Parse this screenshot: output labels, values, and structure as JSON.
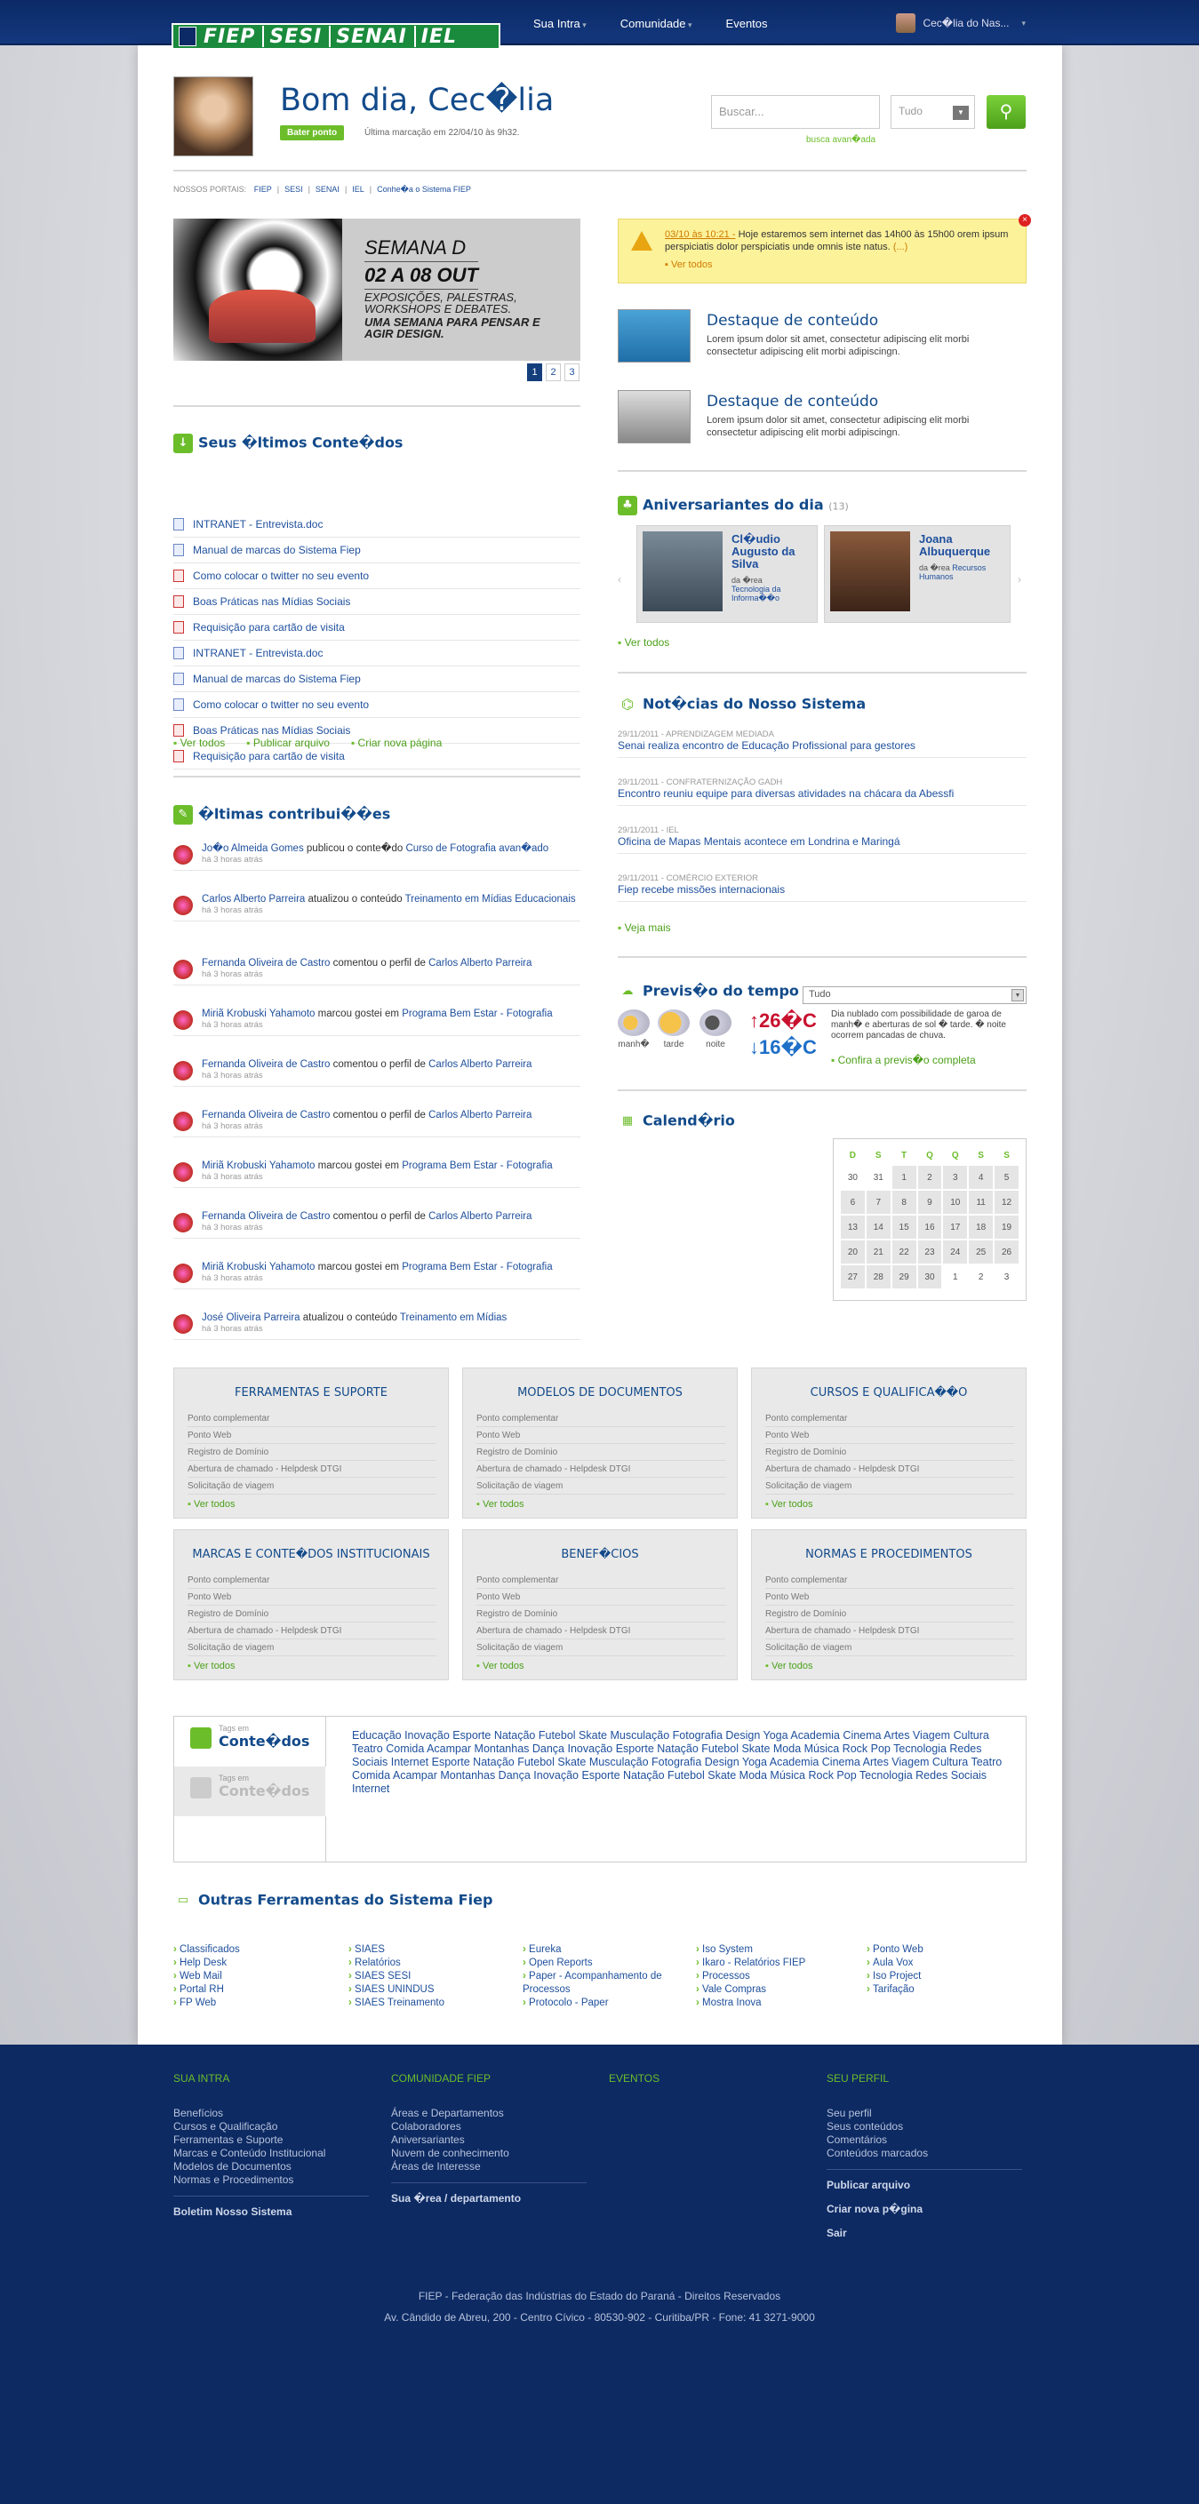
{
  "topbar": {
    "logo": [
      "FIEP",
      "SESI",
      "SENAI",
      "IEL"
    ],
    "nav": [
      {
        "label": "Sua Intra",
        "dropdown": true
      },
      {
        "label": "Comunidade",
        "dropdown": true
      },
      {
        "label": "Eventos",
        "dropdown": false
      }
    ],
    "user": "Cec�lia do Nas..."
  },
  "profile": {
    "greeting": "Bom dia, Cec�lia",
    "punch_button": "Bater ponto",
    "last_mark": "Última marcação em 22/04/10 às 9h32."
  },
  "search": {
    "placeholder": "Buscar...",
    "scope": "Tudo",
    "advanced": "busca avan�ada"
  },
  "portals": {
    "label": "NOSSOS PORTAIS:",
    "links": [
      "FIEP",
      "SESI",
      "SENAI",
      "IEL",
      "Conhe�a o Sistema FIEP"
    ]
  },
  "banner": {
    "title": "SEMANA D",
    "dates": "02 A 08 OUT",
    "body": "EXPOSIÇÕES, PALESTRAS, WORKSHOPS E DEBATES.",
    "tagline": "UMA SEMANA PARA PENSAR E AGIR DESIGN.",
    "pages": [
      "1",
      "2",
      "3"
    ]
  },
  "alert": {
    "date": "03/10 às 10:21 -",
    "text": "Hoje estaremos sem internet das 14h00 às 15h00 orem ipsum perspiciatis dolor perspiciatis unde omnis iste natus.",
    "more": "(...)",
    "see_all": "Ver todos"
  },
  "highlights": [
    {
      "title": "Destaque de conteúdo",
      "text": "Lorem ipsum dolor sit amet, consectetur adipiscing elit morbi consectetur adipiscing elit morbi adipiscingn."
    },
    {
      "title": "Destaque de conteúdo",
      "text": "Lorem ipsum dolor sit amet, consectetur adipiscing elit morbi consectetur adipiscing elit morbi adipiscingn."
    }
  ],
  "contents": {
    "title": "Seus �ltimos Conte�dos",
    "files": [
      {
        "name": "INTRANET - Entrevista.doc",
        "type": "doc"
      },
      {
        "name": "Manual de marcas do Sistema Fiep",
        "type": "doc"
      },
      {
        "name": "Como colocar o twitter no seu evento",
        "type": "pdf"
      },
      {
        "name": "Boas Práticas nas Mídias Sociais",
        "type": "pdf"
      },
      {
        "name": "Requisição para cartão de visita",
        "type": "pdf"
      },
      {
        "name": "INTRANET - Entrevista.doc",
        "type": "doc"
      },
      {
        "name": "Manual de marcas do Sistema Fiep",
        "type": "doc"
      },
      {
        "name": "Como colocar o twitter no seu evento",
        "type": "doc"
      },
      {
        "name": "Boas Práticas nas Mídias Sociais",
        "type": "pdf"
      },
      {
        "name": "Requisição para cartão de visita",
        "type": "pdf"
      }
    ],
    "links": [
      "Ver todos",
      "Publicar arquivo",
      "Criar nova página"
    ]
  },
  "contributions": {
    "title": "�ltimas contribui��es",
    "items": [
      {
        "actor": "Jo�o Almeida Gomes",
        "action": " publicou o conte�do ",
        "target": "Curso de Fotografia avan�ado",
        "time": "há 3 horas atrás"
      },
      {
        "actor": "Carlos Alberto Parreira",
        "action": " atualizou o conteúdo ",
        "target": "Treinamento em Mídias Educacionais",
        "time": "há 3 horas atrás"
      },
      {
        "actor": "Fernanda Oliveira de Castro",
        "action": " comentou o perfil de ",
        "target": "Carlos Alberto Parreira",
        "time": "há 3 horas atrás"
      },
      {
        "actor": "Miriã Krobuski Yahamoto",
        "action": " marcou gostei em ",
        "target": "Programa Bem Estar - Fotografia",
        "time": "há 3 horas atrás"
      },
      {
        "actor": "Fernanda Oliveira de Castro",
        "action": " comentou o perfil de ",
        "target": "Carlos Alberto Parreira",
        "time": "há 3 horas atrás"
      },
      {
        "actor": "Fernanda Oliveira de Castro",
        "action": " comentou o perfil de ",
        "target": "Carlos Alberto Parreira",
        "time": "há 3 horas atrás"
      },
      {
        "actor": "Miriã Krobuski Yahamoto",
        "action": " marcou gostei em ",
        "target": "Programa Bem Estar - Fotografia",
        "time": "há 3 horas atrás"
      },
      {
        "actor": "Fernanda Oliveira de Castro",
        "action": " comentou o perfil de ",
        "target": "Carlos Alberto Parreira",
        "time": "há 3 horas atrás"
      },
      {
        "actor": "Miriã Krobuski Yahamoto",
        "action": " marcou gostei em ",
        "target": "Programa Bem Estar - Fotografia",
        "time": "há 3 horas atrás"
      },
      {
        "actor": "José Oliveira Parreira",
        "action": " atualizou o conteúdo ",
        "target": "Treinamento em Mídias",
        "time": "há 3 horas atrás"
      }
    ]
  },
  "birthdays": {
    "title": "Aniversariantes do dia",
    "count": "(13)",
    "people": [
      {
        "name": "Cl�udio Augusto da Silva",
        "area_label": "da �rea",
        "area": "Tecnologia da Informa��o"
      },
      {
        "name": "Joana Albuquerque",
        "area_label": "da �rea",
        "area": "Recursos Humanos"
      }
    ],
    "see_all": "Ver todos"
  },
  "news": {
    "title": "Not�cias do Nosso Sistema",
    "items": [
      {
        "date": "29/11/2011 - APRENDIZAGEM MEDIADA",
        "title": "Senai realiza encontro de Educação Profissional para gestores"
      },
      {
        "date": "29/11/2011 - CONFRATERNIZAÇÃO GADH",
        "title": "Encontro reuniu equipe para diversas atividades na chácara da Abessfi"
      },
      {
        "date": "29/11/2011 - IEL",
        "title": "Oficina de Mapas Mentais acontece em Londrina e Maringá"
      },
      {
        "date": "29/11/2011 - COMÉRCIO EXTERIOR",
        "title": "Fiep recebe missões internacionais"
      }
    ],
    "more": "Veja mais"
  },
  "weather": {
    "title": "Previs�o do tempo",
    "scope": "Tudo",
    "periods": [
      "manh�",
      "tarde",
      "noite"
    ],
    "max": "↑26�C",
    "min": "↓16�C",
    "desc": "Dia nublado com possibilidade de garoa de manh� e aberturas de sol � tarde. � noite ocorrem pancadas de chuva.",
    "link": "Confira a previs�o completa"
  },
  "calendar": {
    "title": "Calend�rio",
    "days": [
      "D",
      "S",
      "T",
      "Q",
      "Q",
      "S",
      "S"
    ],
    "weeks": [
      [
        "30",
        "31",
        "1",
        "2",
        "3",
        "4",
        "5"
      ],
      [
        "6",
        "7",
        "8",
        "9",
        "10",
        "11",
        "12"
      ],
      [
        "13",
        "14",
        "15",
        "16",
        "17",
        "18",
        "19"
      ],
      [
        "20",
        "21",
        "22",
        "23",
        "24",
        "25",
        "26"
      ],
      [
        "27",
        "28",
        "29",
        "30",
        "1",
        "2",
        "3"
      ]
    ]
  },
  "boxes": [
    {
      "title": "FERRAMENTAS E SUPORTE"
    },
    {
      "title": "MODELOS DE DOCUMENTOS"
    },
    {
      "title": "CURSOS E QUALIFICA��O"
    },
    {
      "title": "MARCAS E CONTE�DOS INSTITUCIONAIS"
    },
    {
      "title": "BENEF�CIOS"
    },
    {
      "title": "NORMAS E PROCEDIMENTOS"
    }
  ],
  "box_items": [
    "Ponto complementar",
    "Ponto Web",
    "Registro de Domínio",
    "Abertura de chamado - Helpdesk DTGI",
    "Solicitação de viagem"
  ],
  "box_see_all": "Ver todos",
  "tags": {
    "tab1_small": "Tags em",
    "tab1": "Conte�dos",
    "tab2_small": "Tags em",
    "tab2": "Conte�dos",
    "cloud": "Educação Inovação Esporte Natação Futebol Skate Musculação Fotografia Design Yoga Academia Cinema Artes Viagem Cultura Teatro Comida Acampar Montanhas Dança Inovação Esporte Natação Futebol Skate Moda Música Rock Pop Tecnologia Redes Sociais Internet Esporte Natação Futebol Skate Musculação Fotografia Design Yoga Academia Cinema Artes Viagem Cultura Teatro Comida Acampar Montanhas Dança Inovação Esporte Natação Futebol Skate Moda Música Rock Pop Tecnologia Redes Sociais Internet"
  },
  "tools": {
    "title": "Outras Ferramentas do Sistema Fiep",
    "cols": [
      [
        "Classificados",
        "Help Desk",
        "Web Mail",
        "Portal RH",
        "FP Web"
      ],
      [
        "SIAES",
        "Relatórios",
        "SIAES SESI",
        "SIAES UNINDUS",
        "SIAES Treinamento"
      ],
      [
        "Eureka",
        "Open Reports",
        "Paper - Acompanhamento de Processos",
        "Protocolo - Paper"
      ],
      [
        "Iso System",
        "Ikaro - Relatórios FIEP",
        "Processos",
        "Vale Compras",
        "Mostra Inova"
      ],
      [
        "Ponto Web",
        "Aula Vox",
        "Iso Project",
        "Tarifação"
      ]
    ]
  },
  "footer": {
    "cols": [
      {
        "title": "SUA INTRA",
        "items": [
          "Benefícios",
          "Cursos e Qualificação",
          "Ferramentas e Suporte",
          "Marcas e Conteúdo Institucional",
          "Modelos de Documentos",
          "Normas e Procedimentos"
        ],
        "bold": [
          "Boletim Nosso Sistema"
        ]
      },
      {
        "title": "COMUNIDADE FIEP",
        "items": [
          "Áreas e Departamentos",
          "Colaboradores",
          "Aniversariantes",
          "Nuvem de conhecimento",
          "Áreas de Interesse"
        ],
        "bold": [
          "Sua �rea / departamento"
        ]
      },
      {
        "title": "EVENTOS",
        "items": [],
        "bold": []
      },
      {
        "title": "SEU PERFIL",
        "items": [
          "Seu perfil",
          "Seus conteúdos",
          "Comentários",
          "Conteúdos marcados"
        ],
        "bold": [
          "Publicar arquivo",
          "Criar nova p�gina",
          "Sair"
        ]
      }
    ],
    "copyright": "FIEP - Federação das Indústrias do Estado do Paraná - Direitos Reservados",
    "address": "Av. Cândido de Abreu, 200 - Centro Cívico - 80530-902 - Curitiba/PR - Fone: 41 3271-9000"
  },
  "colors": {
    "navy": "#0d2a63",
    "green": "#6cbd2a",
    "link": "#1e4f9c"
  }
}
